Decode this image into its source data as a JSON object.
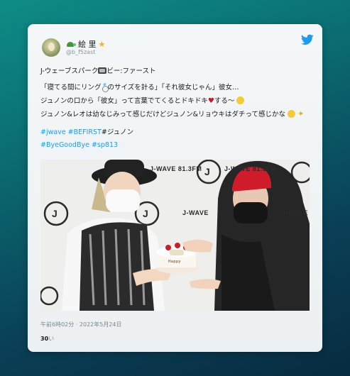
{
  "user": {
    "display_name": "絵 里",
    "handle": "@b_f5zast"
  },
  "tweet": {
    "lines": [
      {
        "before": "J-ウェーブスパーク",
        "after": "ビー:ファースト"
      },
      {
        "before": "「寝てる間にリング",
        "after": "のサイズを計る」「それ彼女じゃん」彼女…"
      },
      {
        "before": "ジュノンの口から「彼女」って言葉でてくるとドキドキ",
        "after": "する〜"
      },
      {
        "before": "ジュノン&レオは幼なじみって感じだけどジュノン&リョウキはダチって感じかな",
        "after": ""
      }
    ],
    "hashtags_line1": {
      "tags": "#jwave #BEFIRST",
      "plain": "#ジュノン"
    },
    "hashtags_line2": "#ByeGoodBye #sp813"
  },
  "photo": {
    "watermark_text": "J-WAVE 81.3FM",
    "watermark_small": "J-WAVE",
    "logo_letter": "J",
    "cake_text": "Happy"
  },
  "meta": {
    "timestamp": "午前6時02分 · 2022年5月24日",
    "likes_count": "30",
    "likes_label": "い"
  },
  "colors": {
    "link": "#1d9bf0",
    "twitter_blue": "#1d9bf0",
    "heart": "#c3162b"
  },
  "icons": [
    "turtle-icon",
    "star-icon",
    "twitter-bird-icon",
    "radio-icon",
    "ring-icon",
    "heart-icon",
    "laugh-emoji-icon",
    "worried-emoji-icon",
    "sparkle-icon"
  ]
}
